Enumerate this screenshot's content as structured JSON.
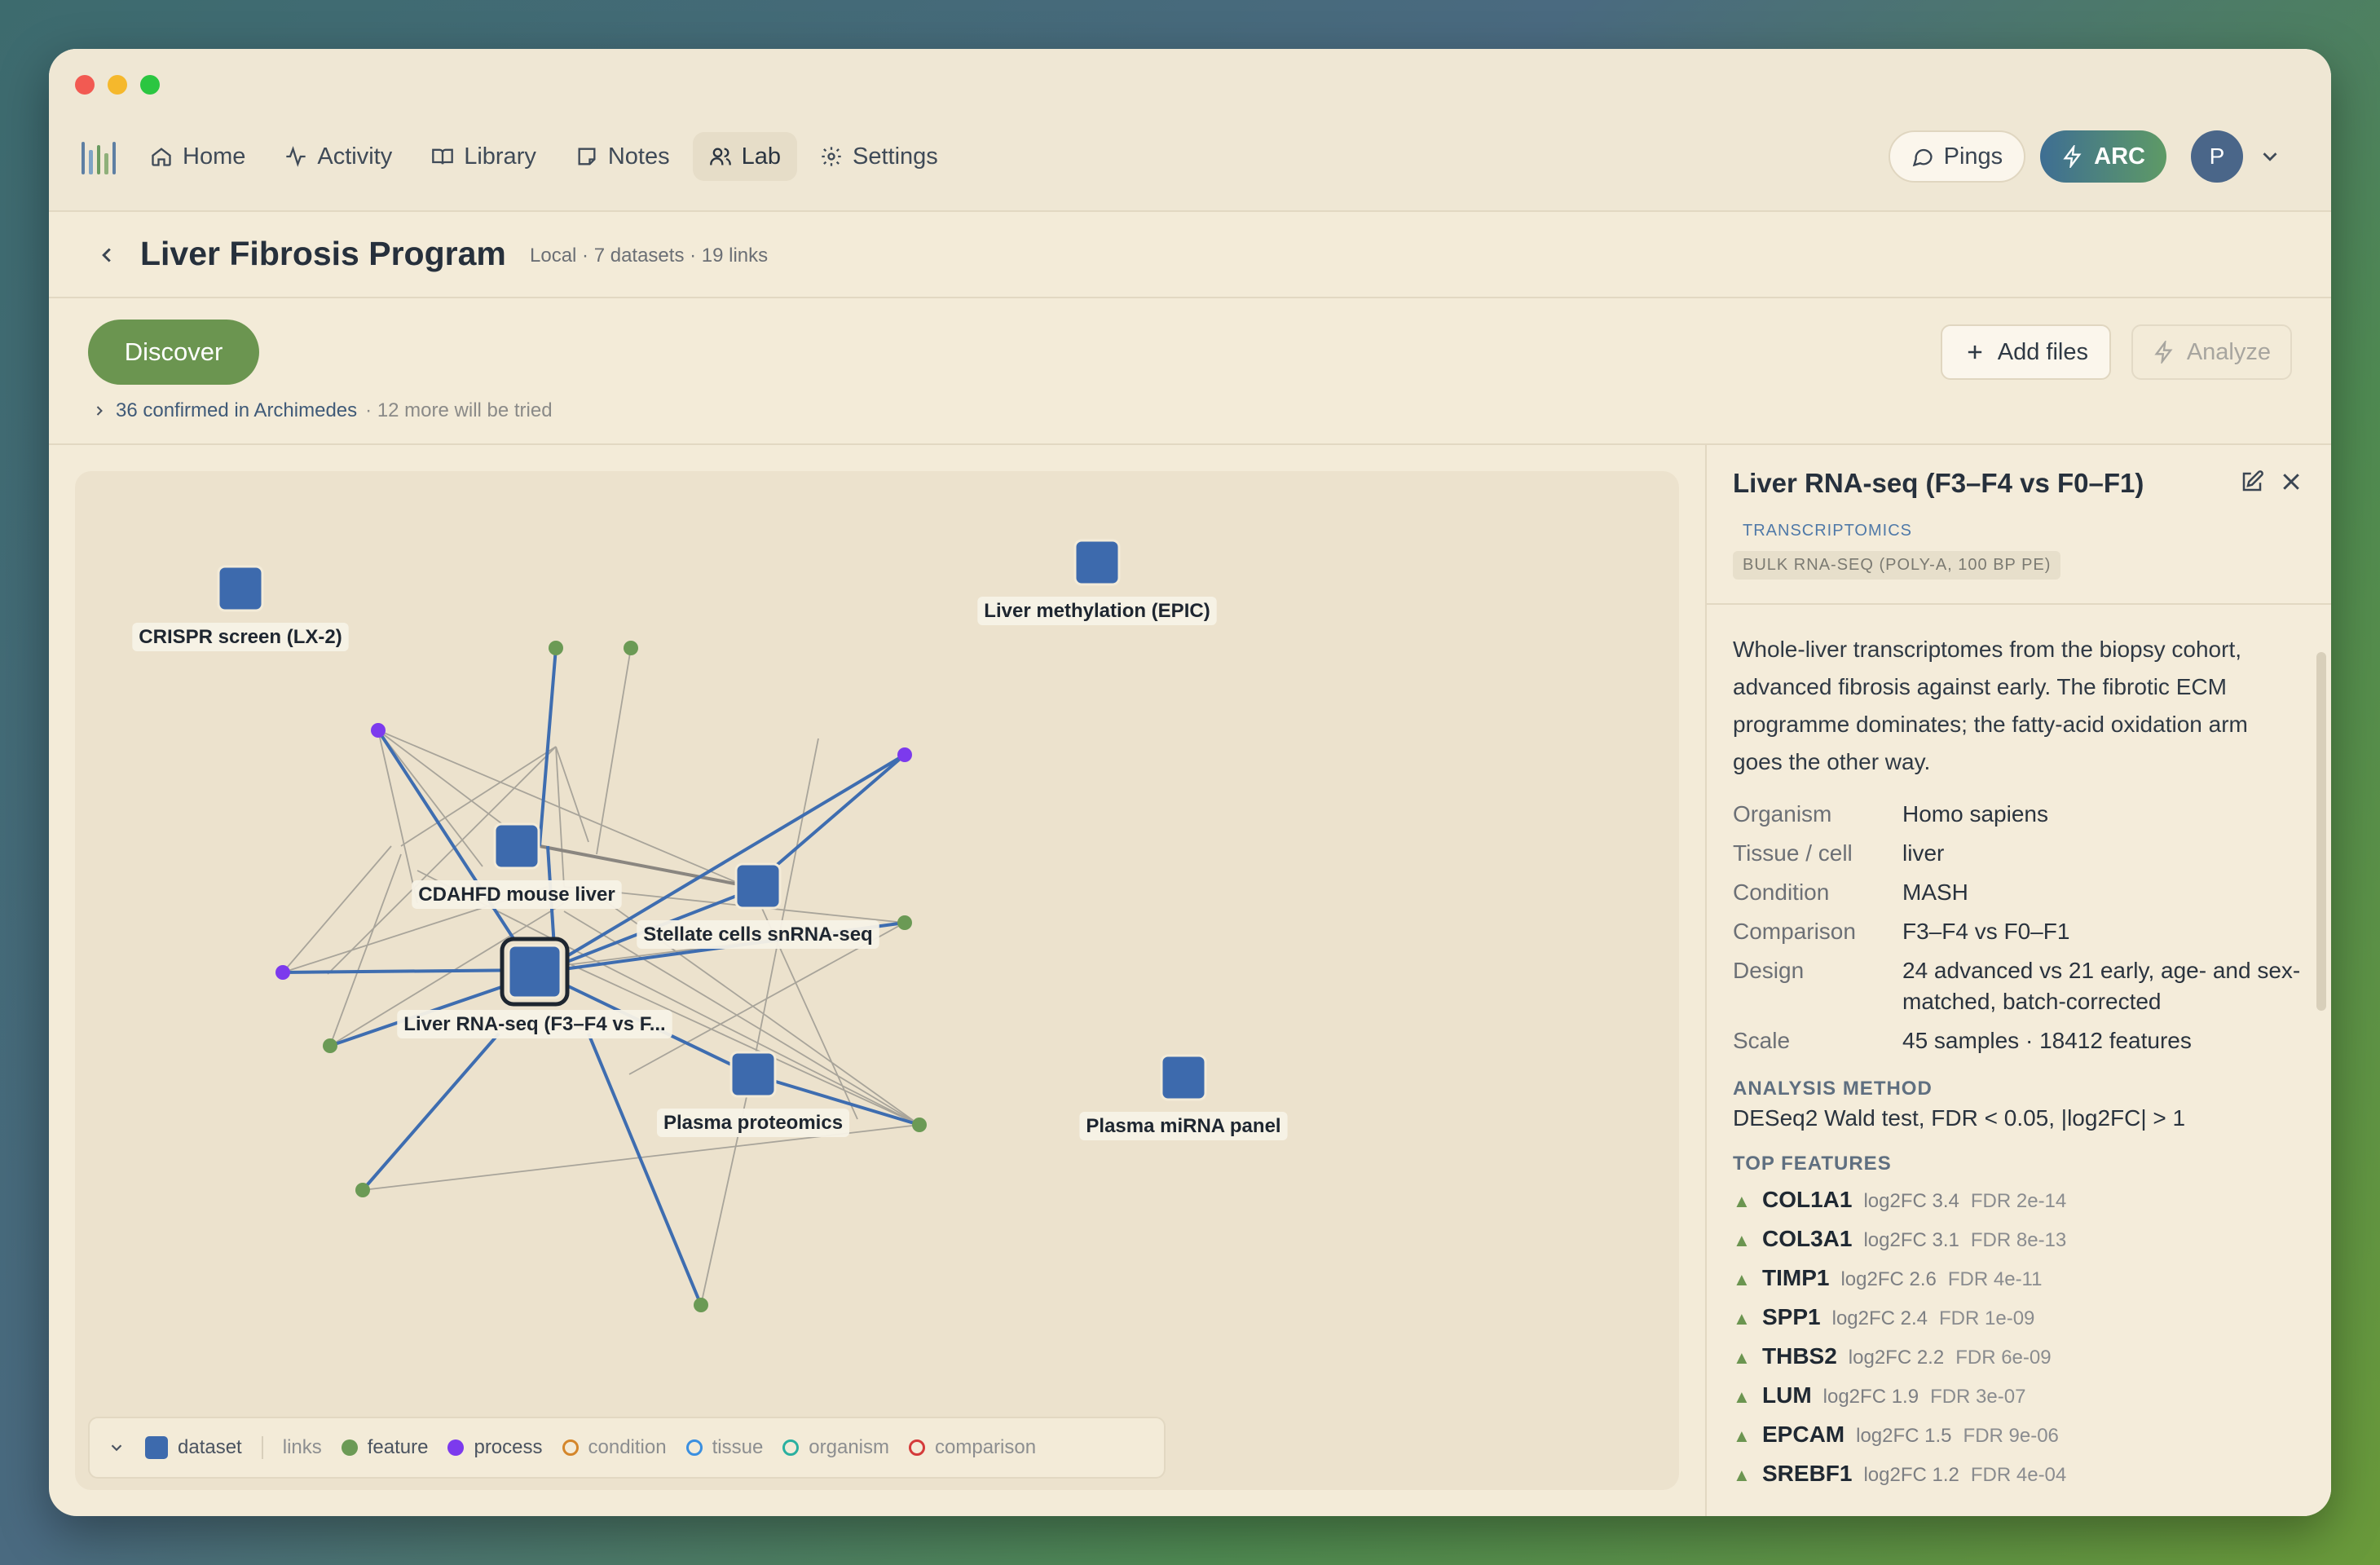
{
  "nav": {
    "items": [
      {
        "label": "Home",
        "icon": "home-icon"
      },
      {
        "label": "Activity",
        "icon": "activity-icon"
      },
      {
        "label": "Library",
        "icon": "book-icon"
      },
      {
        "label": "Notes",
        "icon": "note-icon"
      },
      {
        "label": "Lab",
        "icon": "users-icon",
        "active": true
      },
      {
        "label": "Settings",
        "icon": "gear-icon"
      }
    ],
    "pings_label": "Pings",
    "arc_label": "ARC",
    "avatar_initial": "P"
  },
  "header": {
    "title": "Liver Fibrosis Program",
    "meta": "Local · 7 datasets · 19 links"
  },
  "actions": {
    "discover_label": "Discover",
    "confirmed_text": "36 confirmed in Archimedes",
    "more_text": "· 12 more will be tried",
    "add_files_label": "Add files",
    "analyze_label": "Analyze"
  },
  "graph": {
    "datasets": [
      {
        "id": "crispr",
        "label": "CRISPR screen (LX-2)"
      },
      {
        "id": "methyl",
        "label": "Liver methylation (EPIC)"
      },
      {
        "id": "cdahfd",
        "label": "CDAHFD mouse liver"
      },
      {
        "id": "stellate",
        "label": "Stellate cells snRNA-seq"
      },
      {
        "id": "rnaseq",
        "label": "Liver RNA-seq (F3–F4 vs F...",
        "selected": true
      },
      {
        "id": "proteomics",
        "label": "Plasma proteomics"
      },
      {
        "id": "mirna",
        "label": "Plasma miRNA panel"
      }
    ],
    "colors": {
      "dataset": "#3d6aad",
      "feature": "#6b9a55",
      "process": "#7c3aed",
      "strong_link": "#3e6db0",
      "weak_link": "#a8a49a"
    }
  },
  "legend": {
    "items": [
      {
        "label": "dataset",
        "kind": "square",
        "color": "#3d6aad"
      },
      {
        "label": "links",
        "kind": "text",
        "dim": true
      },
      {
        "label": "feature",
        "kind": "dot",
        "color": "#6b9a55"
      },
      {
        "label": "process",
        "kind": "dot",
        "color": "#7c3aed"
      },
      {
        "label": "condition",
        "kind": "ring",
        "color": "#d4862a",
        "dim": true
      },
      {
        "label": "tissue",
        "kind": "ring",
        "color": "#3a8fe0",
        "dim": true
      },
      {
        "label": "organism",
        "kind": "ring",
        "color": "#2ab0a0",
        "dim": true
      },
      {
        "label": "comparison",
        "kind": "ring",
        "color": "#d43a3a",
        "dim": true
      }
    ]
  },
  "panel": {
    "title": "Liver RNA-seq (F3–F4 vs F0–F1)",
    "tag_primary": "TRANSCRIPTOMICS",
    "tag_secondary": "BULK RNA-SEQ (POLY-A, 100 BP PE)",
    "description": "Whole-liver transcriptomes from the biopsy cohort, advanced fibrosis against early. The fibrotic ECM programme dominates; the fatty-acid oxidation arm goes the other way.",
    "properties": [
      {
        "key": "Organism",
        "value": "Homo sapiens"
      },
      {
        "key": "Tissue / cell",
        "value": "liver"
      },
      {
        "key": "Condition",
        "value": "MASH"
      },
      {
        "key": "Comparison",
        "value": "F3–F4 vs F0–F1"
      },
      {
        "key": "Design",
        "value": "24 advanced vs 21 early, age- and sex-matched, batch-corrected"
      },
      {
        "key": "Scale",
        "value": "45 samples · 18412 features"
      }
    ],
    "method_heading": "ANALYSIS METHOD",
    "method": "DESeq2 Wald test, FDR < 0.05, |log2FC| > 1",
    "features_heading": "TOP FEATURES",
    "features": [
      {
        "name": "COL1A1",
        "fc": "log2FC 3.4",
        "fdr": "FDR 2e-14"
      },
      {
        "name": "COL3A1",
        "fc": "log2FC 3.1",
        "fdr": "FDR 8e-13"
      },
      {
        "name": "TIMP1",
        "fc": "log2FC 2.6",
        "fdr": "FDR 4e-11"
      },
      {
        "name": "SPP1",
        "fc": "log2FC 2.4",
        "fdr": "FDR 1e-09"
      },
      {
        "name": "THBS2",
        "fc": "log2FC 2.2",
        "fdr": "FDR 6e-09"
      },
      {
        "name": "LUM",
        "fc": "log2FC 1.9",
        "fdr": "FDR 3e-07"
      },
      {
        "name": "EPCAM",
        "fc": "log2FC 1.5",
        "fdr": "FDR 9e-06"
      },
      {
        "name": "SREBF1",
        "fc": "log2FC 1.2",
        "fdr": "FDR 4e-04"
      }
    ]
  }
}
